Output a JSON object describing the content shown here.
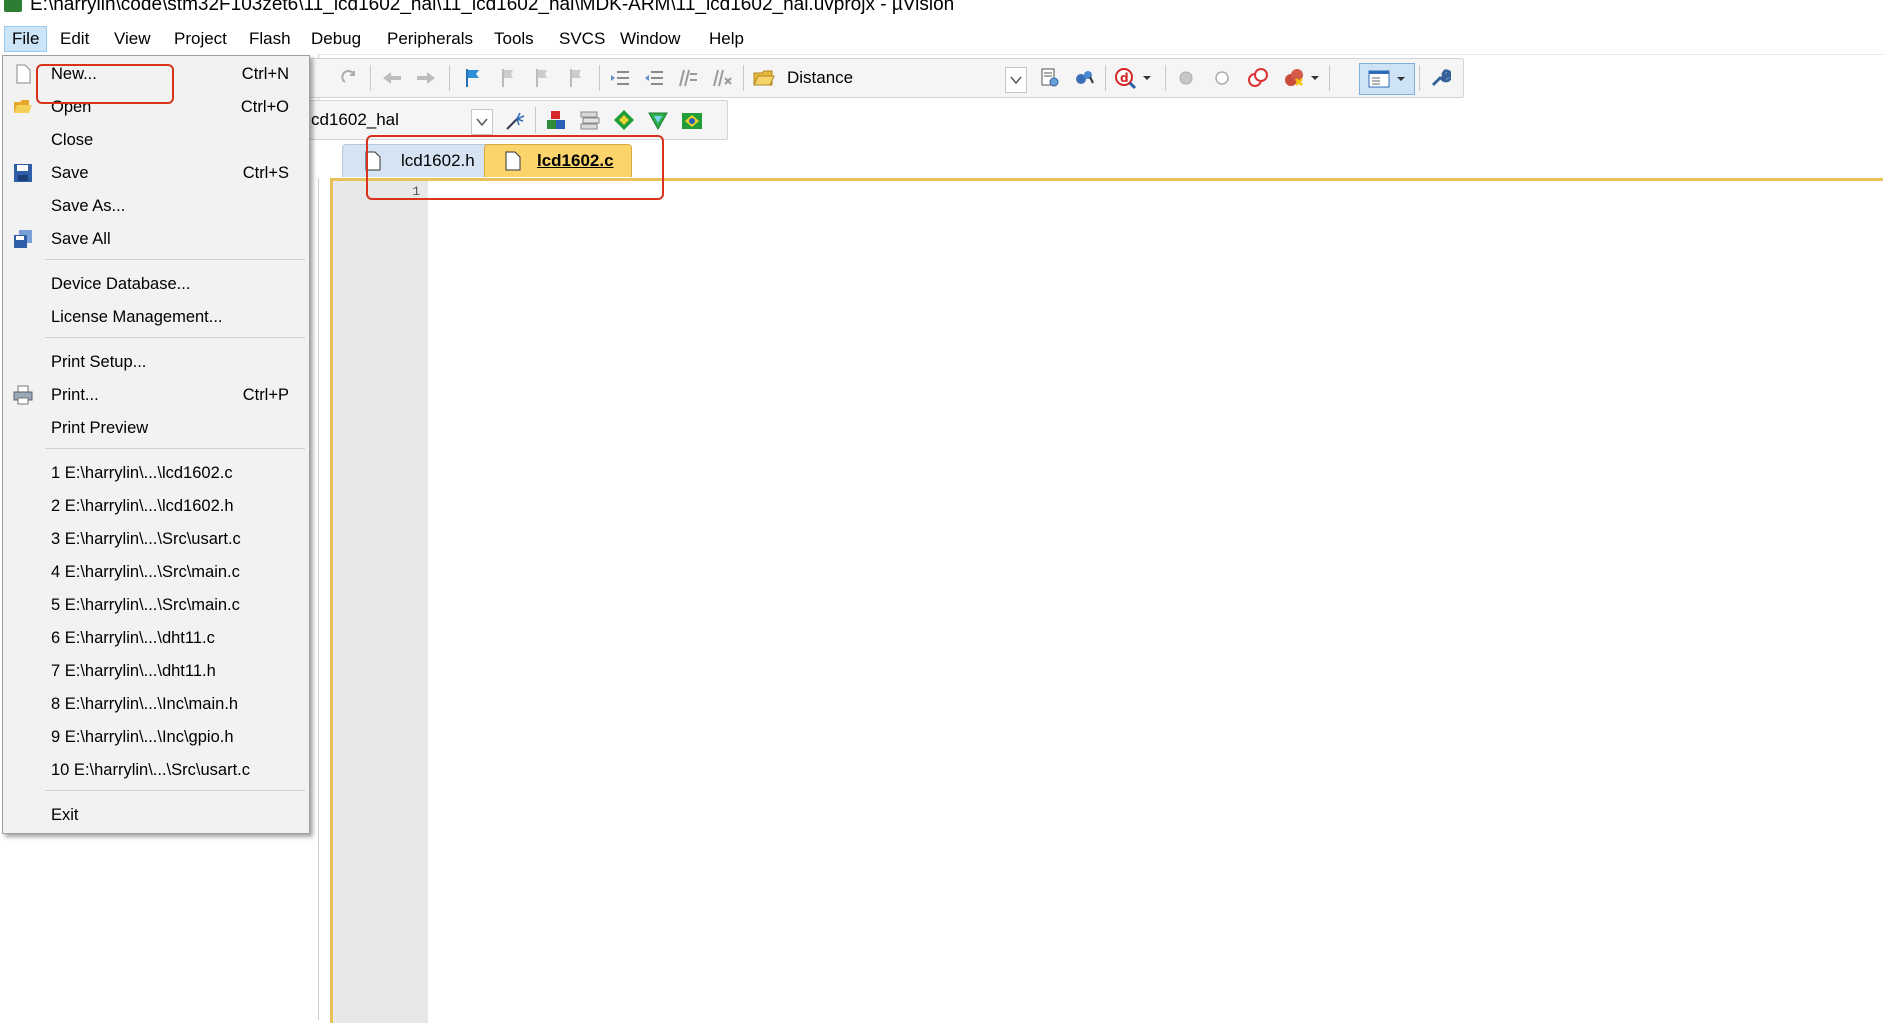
{
  "window": {
    "title": "E:\\harrylin\\code\\stm32F103zet6\\11_lcd1602_hal\\11_lcd1602_hal\\MDK-ARM\\11_lcd1602_hal.uvprojx - µVision"
  },
  "menubar": {
    "items": [
      "File",
      "Edit",
      "View",
      "Project",
      "Flash",
      "Debug",
      "Peripherals",
      "Tools",
      "SVCS",
      "Window",
      "Help"
    ]
  },
  "toolbar": {
    "find_combo_value": "Distance",
    "target_combo_value": "cd1602_hal"
  },
  "file_menu": {
    "new": {
      "label": "New...",
      "shortcut": "Ctrl+N"
    },
    "open": {
      "label": "Open",
      "shortcut": "Ctrl+O"
    },
    "close": {
      "label": "Close"
    },
    "save": {
      "label": "Save",
      "shortcut": "Ctrl+S"
    },
    "save_as": {
      "label": "Save As..."
    },
    "save_all": {
      "label": "Save All"
    },
    "device_database": {
      "label": "Device Database..."
    },
    "license_management": {
      "label": "License Management..."
    },
    "print_setup": {
      "label": "Print Setup..."
    },
    "print": {
      "label": "Print...",
      "shortcut": "Ctrl+P"
    },
    "print_preview": {
      "label": "Print Preview"
    },
    "recent": [
      "1 E:\\harrylin\\...\\lcd1602.c",
      "2 E:\\harrylin\\...\\lcd1602.h",
      "3 E:\\harrylin\\...\\Src\\usart.c",
      "4 E:\\harrylin\\...\\Src\\main.c",
      "5 E:\\harrylin\\...\\Src\\main.c",
      "6 E:\\harrylin\\...\\dht11.c",
      "7 E:\\harrylin\\...\\dht11.h",
      "8 E:\\harrylin\\...\\Inc\\main.h",
      "9 E:\\harrylin\\...\\Inc\\gpio.h",
      "10 E:\\harrylin\\...\\Src\\usart.c"
    ],
    "exit": {
      "label": "Exit"
    }
  },
  "editor": {
    "tabs": [
      {
        "label": "lcd1602.h",
        "active": false
      },
      {
        "label": "lcd1602.c",
        "active": true
      }
    ],
    "line_numbers": [
      "1"
    ]
  },
  "colors": {
    "highlight_red": "#d9331e",
    "active_tab": "#fbd56b",
    "menu_active": "#cce4f7"
  }
}
